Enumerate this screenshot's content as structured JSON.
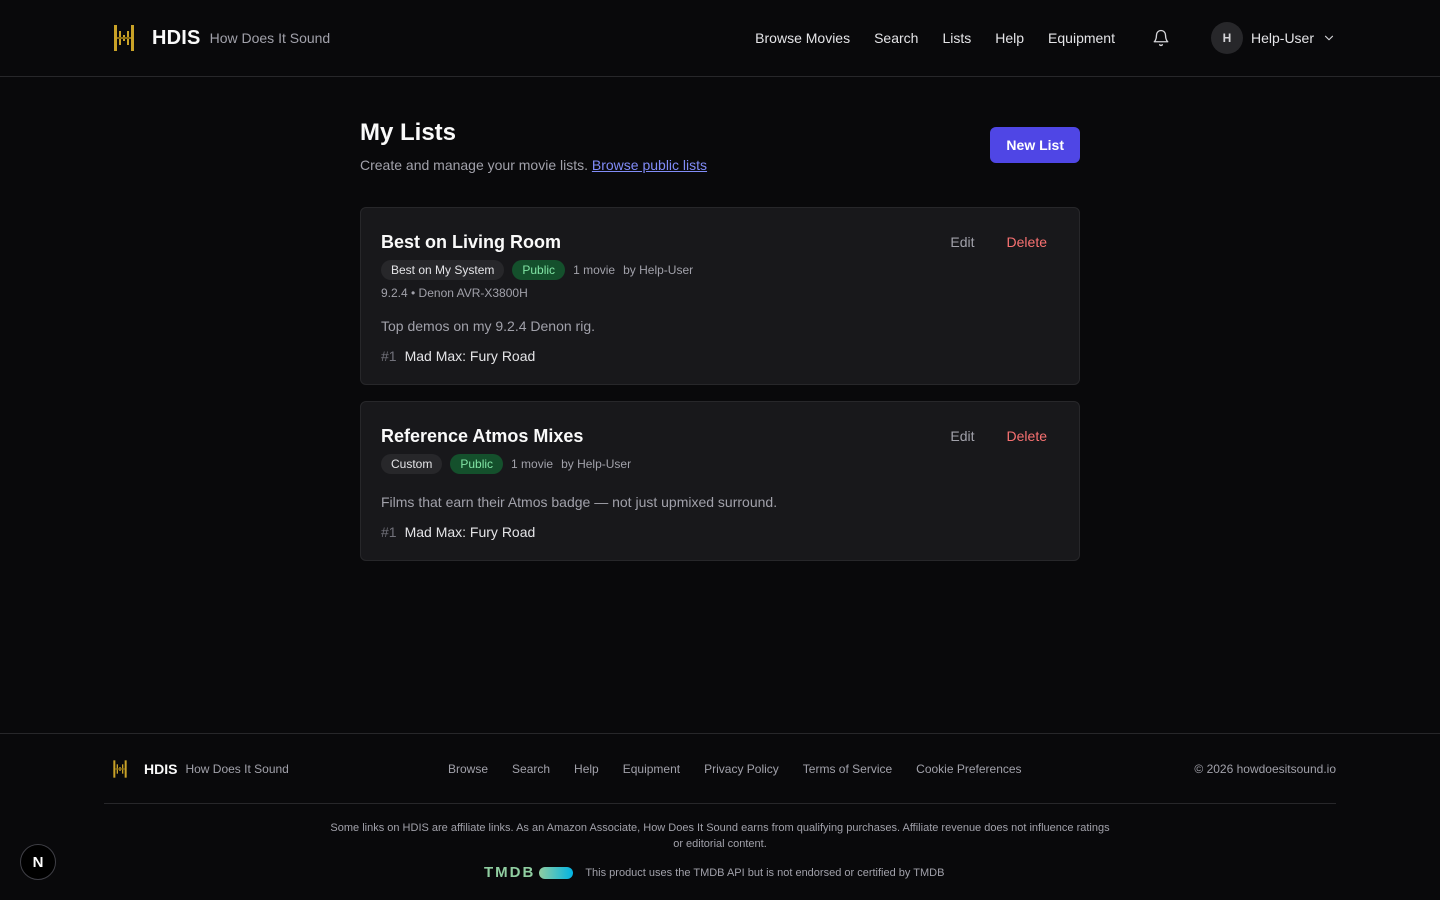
{
  "header": {
    "brand_name": "HDIS",
    "brand_tagline": "How Does It Sound",
    "nav": [
      "Browse Movies",
      "Search",
      "Lists",
      "Help",
      "Equipment"
    ],
    "avatar_initial": "H",
    "user_name": "Help-User"
  },
  "page": {
    "title": "My Lists",
    "subtitle": "Create and manage your movie lists.",
    "browse_link": "Browse public lists",
    "new_button": "New List"
  },
  "lists": [
    {
      "title": "Best on Living Room",
      "type_badge": "Best on My System",
      "visibility": "Public",
      "count": "1 movie",
      "owner": "by Help-User",
      "system": "9.2.4 • Denon AVR-X3800H",
      "description": "Top demos on my 9.2.4 Denon rig.",
      "movies": [
        {
          "rank": "#1",
          "title": "Mad Max: Fury Road"
        }
      ]
    },
    {
      "title": "Reference Atmos Mixes",
      "type_badge": "Custom",
      "visibility": "Public",
      "count": "1 movie",
      "owner": "by Help-User",
      "description": "Films that earn their Atmos badge — not just upmixed surround.",
      "movies": [
        {
          "rank": "#1",
          "title": "Mad Max: Fury Road"
        }
      ]
    }
  ],
  "card_actions": {
    "edit": "Edit",
    "delete": "Delete"
  },
  "footer": {
    "brand_name": "HDIS",
    "brand_tagline": "How Does It Sound",
    "links": [
      "Browse",
      "Search",
      "Help",
      "Equipment",
      "Privacy Policy",
      "Terms of Service",
      "Cookie Preferences"
    ],
    "copyright": "© 2026 howdoesitsound.io",
    "affiliate": "Some links on HDIS are affiliate links. As an Amazon Associate, How Does It Sound earns from qualifying purchases. Affiliate revenue does not influence ratings or editorial content.",
    "tmdb_logo": "TMDB",
    "tmdb_note": "This product uses the TMDB API but is not endorsed or certified by TMDB"
  },
  "dev_badge": "N",
  "colors": {
    "accent": "#4f46e5",
    "danger": "#f87171",
    "public_badge": "#86efac",
    "logo_gold": "#c9a227"
  }
}
